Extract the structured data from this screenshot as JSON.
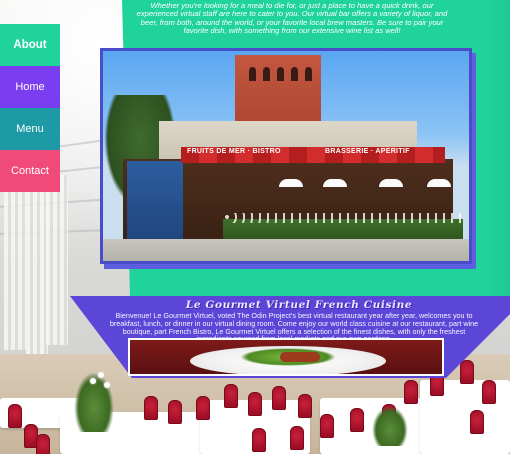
{
  "nav": {
    "items": [
      {
        "label": "About",
        "color": "#20d39a",
        "active": true
      },
      {
        "label": "Home",
        "color": "#7a3ef0",
        "active": false
      },
      {
        "label": "Menu",
        "color": "#1e9aa6",
        "active": false
      },
      {
        "label": "Contact",
        "color": "#f04a7a",
        "active": false
      }
    ]
  },
  "cube": {
    "top_color": "#20d39a",
    "bottom_color": "#5b46d8",
    "intro_text": "Whether you're looking for a meal to die for, or just a place to have a quick drink, our experienced virtual staff are here to cater to you. Our virtual bar offers a variety of liquor, and beer, from both, around the world, or your favorite local brew masters. Be sure to pair your favorite dish, with something from our extensive wine list as well!",
    "storefront_photo": {
      "sign_left": "FRUITS DE MER · BISTRO",
      "sign_right": "BRASSERIE · APERITIF"
    },
    "bottom_title": "Le Gourmet Virtuel French Cuisine",
    "bottom_text": "Bienvenue! Le Gourmet Virtuel, voted The Odin Project's best virtual restaurant year after year, welcomes you to breakfast, lunch, or dinner in our virtual dining room. Come enjoy our world class cuisine at our restaurant, part wine boutique, part French Bistro, Le Gourmet Virtuel offers a selection of the finest dishes, with only the freshest ingredients sourced from local markets and our own gardens."
  },
  "background": {
    "scene": "restaurant-dining-room",
    "chair_color": "#b0152c"
  }
}
